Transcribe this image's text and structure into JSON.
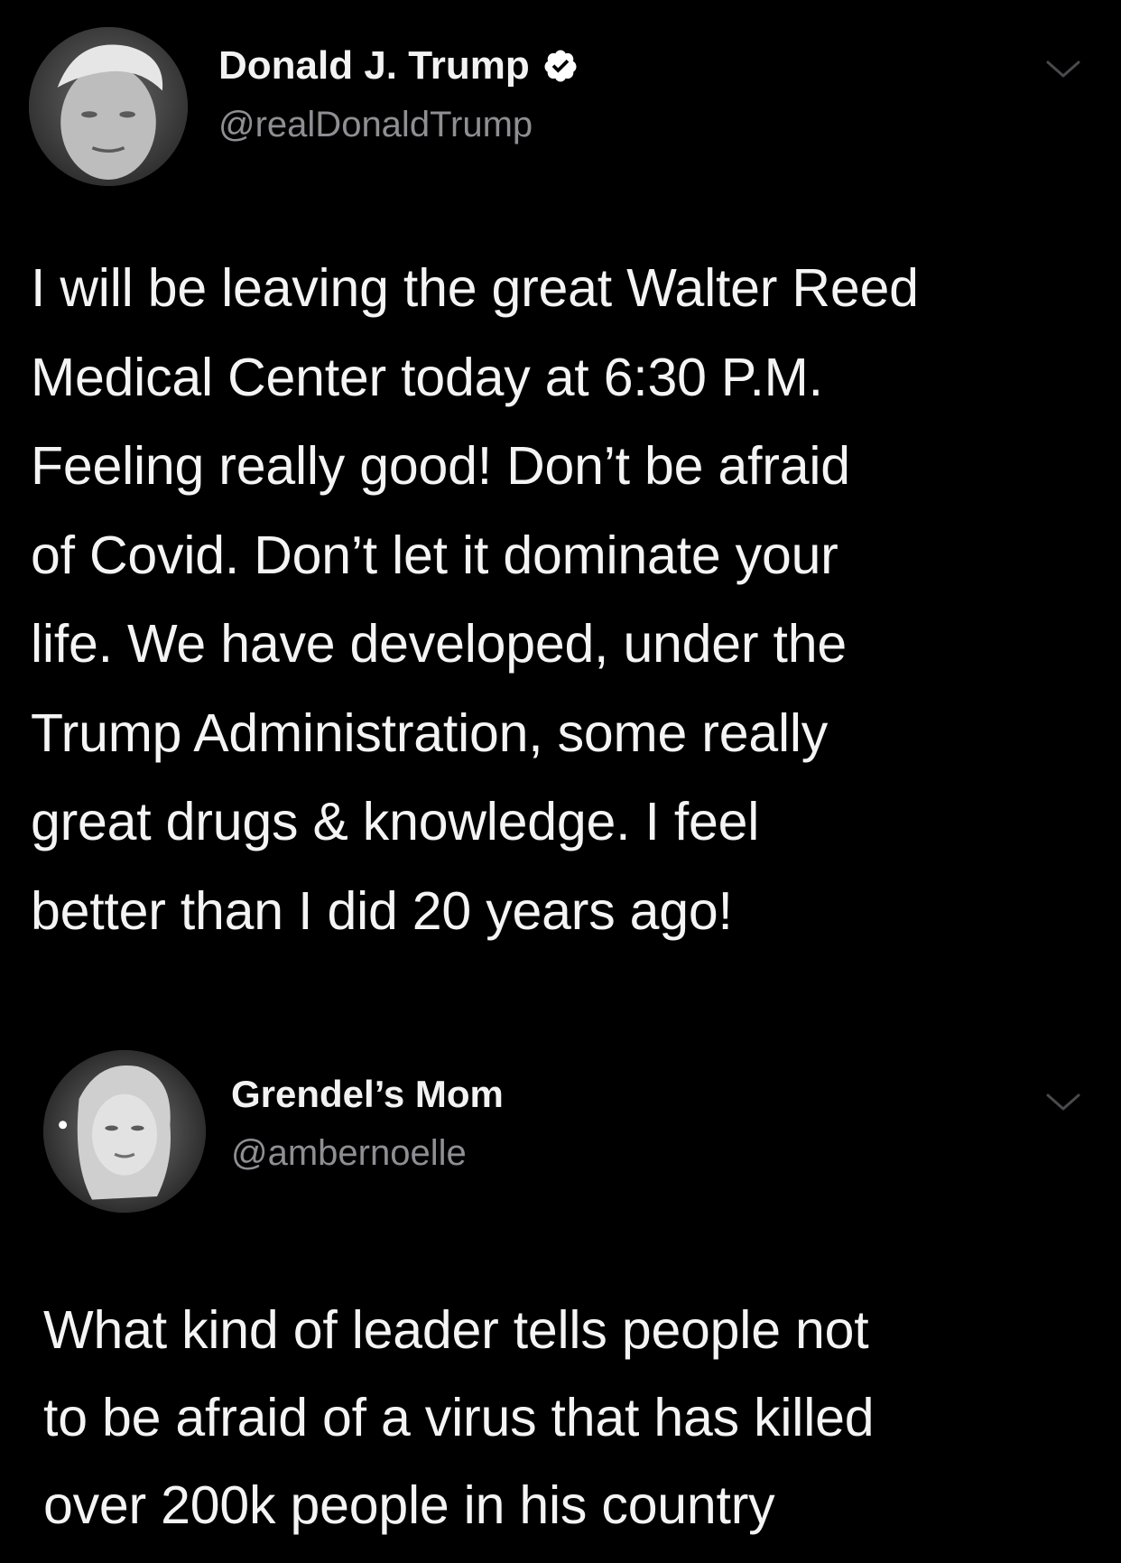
{
  "tweets": [
    {
      "display_name": "Donald J. Trump",
      "handle": "@realDonaldTrump",
      "verified": true,
      "avatar_icon": "profile-photo",
      "menu_icon": "chevron-down-icon",
      "text_lines": [
        "I will be leaving the great Walter Reed",
        "Medical Center today at 6:30 P.M.",
        "Feeling really good! Don’t be afraid",
        "of Covid. Don’t let it dominate your",
        "life. We have developed, under the",
        "Trump Administration, some really",
        "great drugs & knowledge. I feel",
        "better than I did 20 years ago!"
      ]
    },
    {
      "display_name": "Grendel’s Mom",
      "handle": "@ambernoelle",
      "verified": false,
      "avatar_icon": "profile-photo",
      "menu_icon": "chevron-down-icon",
      "text_lines": [
        "What kind of leader tells people not",
        "to be afraid of a virus that has killed",
        "over 200k people in his country"
      ]
    }
  ],
  "colors": {
    "background": "#000000",
    "text": "#f4f4f4",
    "secondary": "#8e8e93",
    "verified_badge": "#ffffff"
  }
}
